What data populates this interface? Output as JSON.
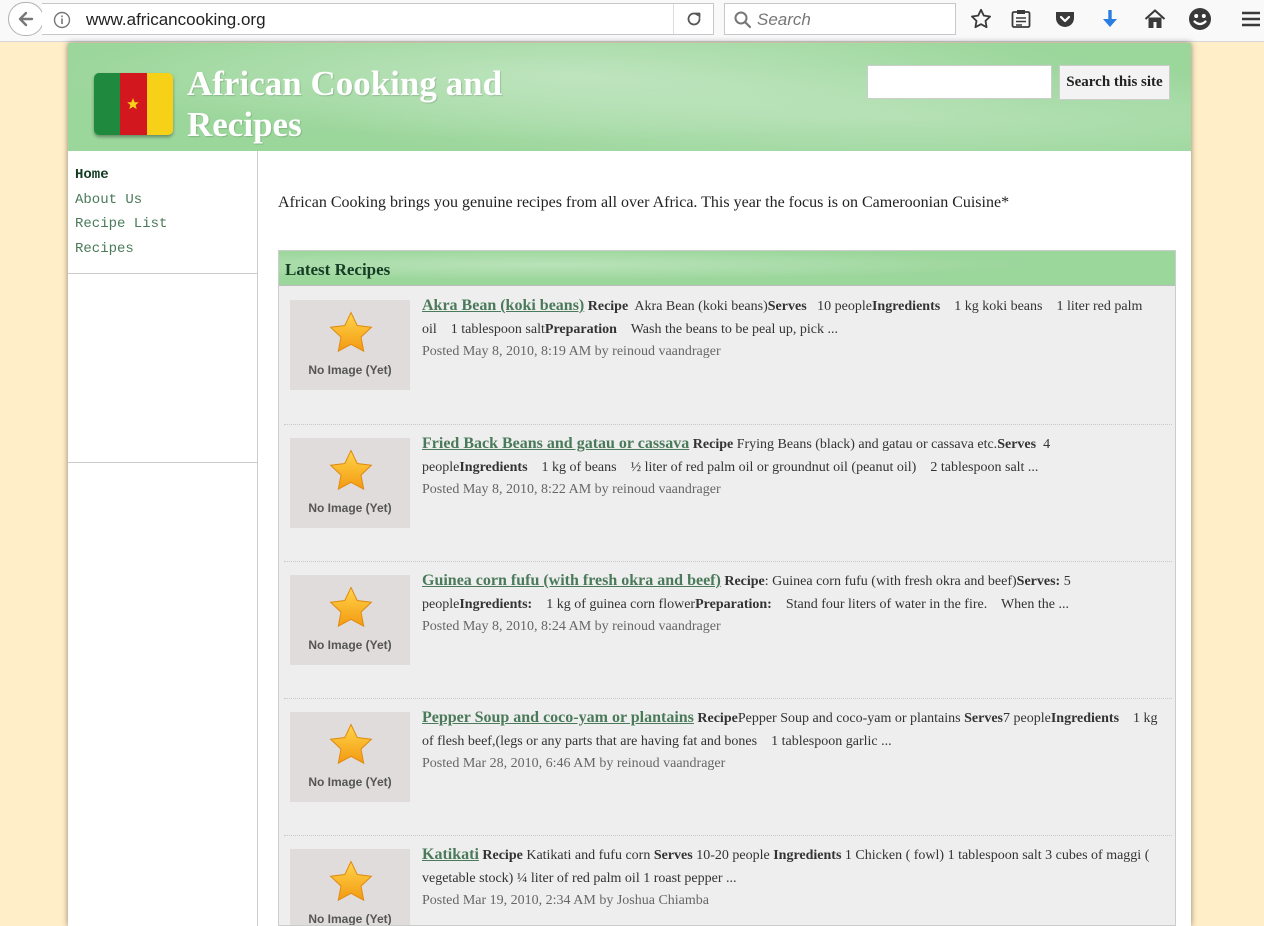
{
  "browser": {
    "url": "www.africancooking.org",
    "search_placeholder": "Search"
  },
  "site": {
    "title": "African Cooking and Recipes",
    "search_button": "Search this site",
    "search_value": ""
  },
  "nav": [
    "Home",
    "About Us",
    "Recipe List",
    "Recipes"
  ],
  "intro": "African Cooking brings you genuine recipes from all over Africa. This year the focus is on Cameroonian Cuisine*",
  "latest": {
    "heading": "Latest Recipes",
    "no_image": "No Image (Yet)",
    "items": [
      {
        "title": "Akra Bean (koki beans)",
        "summary": [
          {
            "b": "Recipe"
          },
          {
            "t": "  Akra Bean (koki beans)"
          },
          {
            "b": "Serves"
          },
          {
            "t": "   10 people"
          },
          {
            "b": "Ingredients"
          },
          {
            "t": "    1 kg koki beans    1 liter red palm oil    1 tablespoon salt"
          },
          {
            "b": "Preparation"
          },
          {
            "t": "    Wash the beans to be peal up, pick ..."
          }
        ],
        "meta": "Posted May 8, 2010, 8:19 AM by reinoud vaandrager"
      },
      {
        "title": "Fried Back Beans and gatau or cassava",
        "summary": [
          {
            "b": "Recipe"
          },
          {
            "t": " Frying Beans (black) and gatau or cassava etc."
          },
          {
            "b": "Serves"
          },
          {
            "t": "  4 people"
          },
          {
            "b": "Ingredients"
          },
          {
            "t": "    1 kg of beans    ½ liter of red palm oil or groundnut oil (peanut oil)    2 tablespoon salt ..."
          }
        ],
        "meta": "Posted May 8, 2010, 8:22 AM by reinoud vaandrager"
      },
      {
        "title": "Guinea corn fufu (with fresh okra and beef)",
        "summary": [
          {
            "b": "Recipe"
          },
          {
            "t": ": Guinea corn fufu (with fresh okra and beef)"
          },
          {
            "b": "Serves:"
          },
          {
            "t": " 5 people"
          },
          {
            "b": "Ingredients:"
          },
          {
            "t": "    1 kg of guinea corn flower"
          },
          {
            "b": "Preparation:"
          },
          {
            "t": "    Stand four liters of water in the fire.    When the ..."
          }
        ],
        "meta": "Posted May 8, 2010, 8:24 AM by reinoud vaandrager"
      },
      {
        "title": "Pepper Soup and coco-yam or plantains",
        "summary": [
          {
            "b": "Recipe"
          },
          {
            "t": "Pepper Soup and coco-yam or plantains "
          },
          {
            "b": "Serves"
          },
          {
            "t": "7 people"
          },
          {
            "b": "Ingredients"
          },
          {
            "t": "    1 kg of flesh beef,(legs or any parts that are having fat and bones    1 tablespoon garlic ..."
          }
        ],
        "meta": "Posted Mar 28, 2010, 6:46 AM by reinoud vaandrager"
      },
      {
        "title": "Katikati",
        "summary": [
          {
            "b": "Recipe"
          },
          {
            "t": " Katikati and fufu corn "
          },
          {
            "b": "Serves"
          },
          {
            "t": " 10-20 people "
          },
          {
            "b": "Ingredients"
          },
          {
            "t": " 1 Chicken ( fowl) 1 tablespoon salt 3 cubes of maggi ( vegetable stock) ¼ liter of red palm oil 1 roast pepper ..."
          }
        ],
        "meta": "Posted Mar 19, 2010, 2:34 AM by Joshua Chiamba"
      }
    ]
  },
  "icons": {
    "toolbar": [
      "bookmark-star-icon",
      "reading-list-icon",
      "pocket-icon",
      "download-icon",
      "home-icon",
      "smiley-icon",
      "menu-icon"
    ],
    "thumbnail": "star-icon",
    "flag": "cameroon-flag"
  },
  "colors": {
    "header_green": "#9bd69b",
    "link_green": "#4a7a5a",
    "page_bg": "#ffeec8",
    "download_blue": "#2a7de1"
  }
}
